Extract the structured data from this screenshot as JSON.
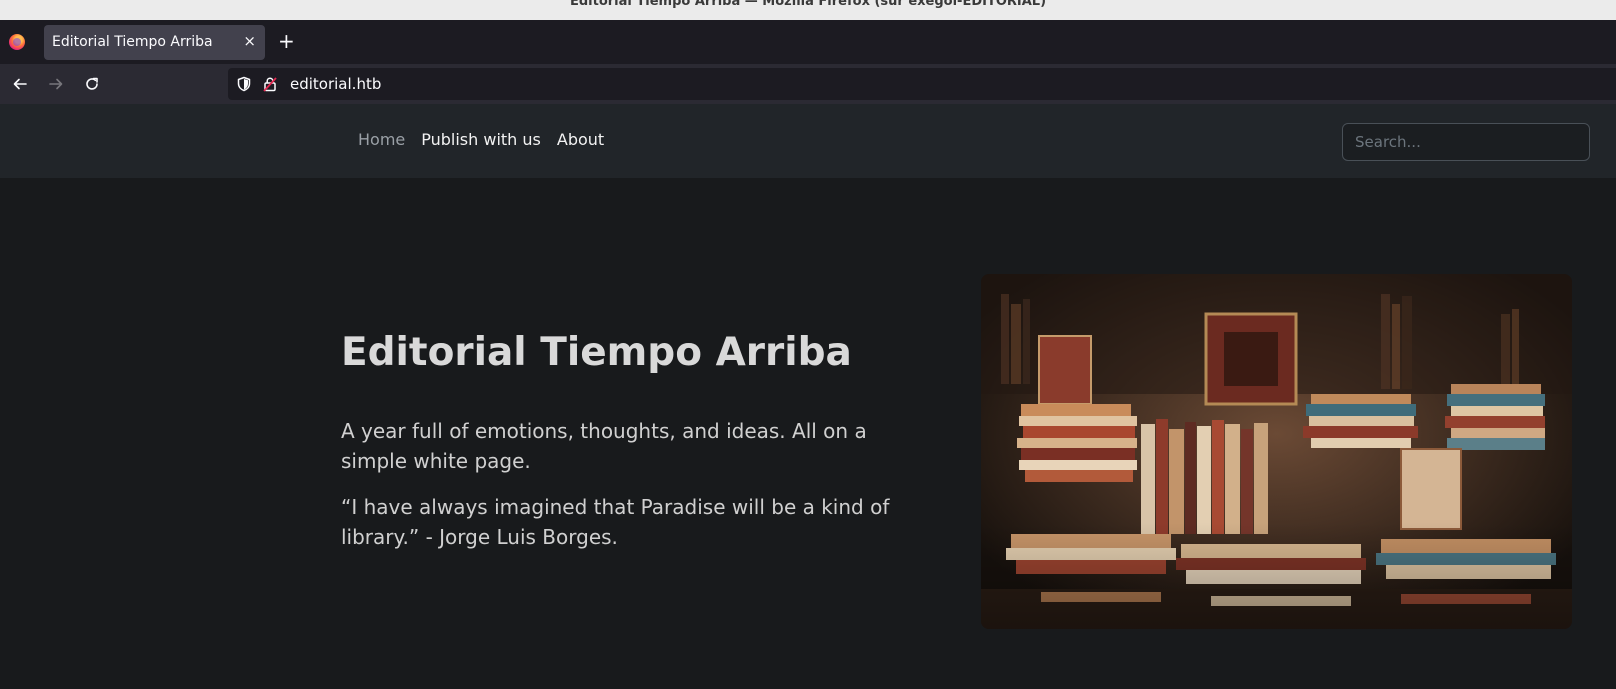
{
  "window": {
    "title": "Editorial Tiempo Arriba — Mozilla Firefox (sur exegol-EDITORIAL)"
  },
  "browser": {
    "tab": {
      "title": "Editorial Tiempo Arriba",
      "close_label": "×"
    },
    "new_tab_label": "+",
    "url": "editorial.htb"
  },
  "site": {
    "nav": {
      "items": [
        {
          "label": "Home",
          "active": true
        },
        {
          "label": "Publish with us",
          "active": false
        },
        {
          "label": "About",
          "active": false
        }
      ],
      "search_placeholder": "Search..."
    },
    "hero": {
      "title": "Editorial Tiempo Arriba",
      "lead": "A year full of emotions, thoughts, and ideas. All on a simple white page.",
      "quote": "“I have always imagined that Paradise will be a kind of library.” - Jorge Luis Borges."
    }
  },
  "colors": {
    "page_background": "#181a1c",
    "navbar_background": "#212529",
    "browser_chrome": "#1c1b22"
  }
}
